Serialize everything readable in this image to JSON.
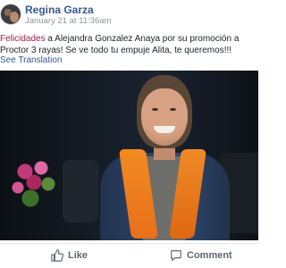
{
  "post": {
    "author": "Regina Garza",
    "timestamp": "January 21 at 11:36am",
    "text_highlight": "Felicidades",
    "text_rest": " a Alejandra Gonzalez Anaya por su promoción a Proctor 3 rayas! Se ve todo tu empuje Alita, te queremos!!!",
    "see_translation": "See Translation"
  },
  "actions": {
    "like_label": "Like",
    "comment_label": "Comment"
  },
  "colors": {
    "author_link": "#365899",
    "highlight_text": "#a01c4b",
    "meta_gray": "#90949c",
    "action_gray": "#606770"
  },
  "icons": [
    "avatar",
    "like-thumb-icon",
    "comment-bubble-icon"
  ]
}
